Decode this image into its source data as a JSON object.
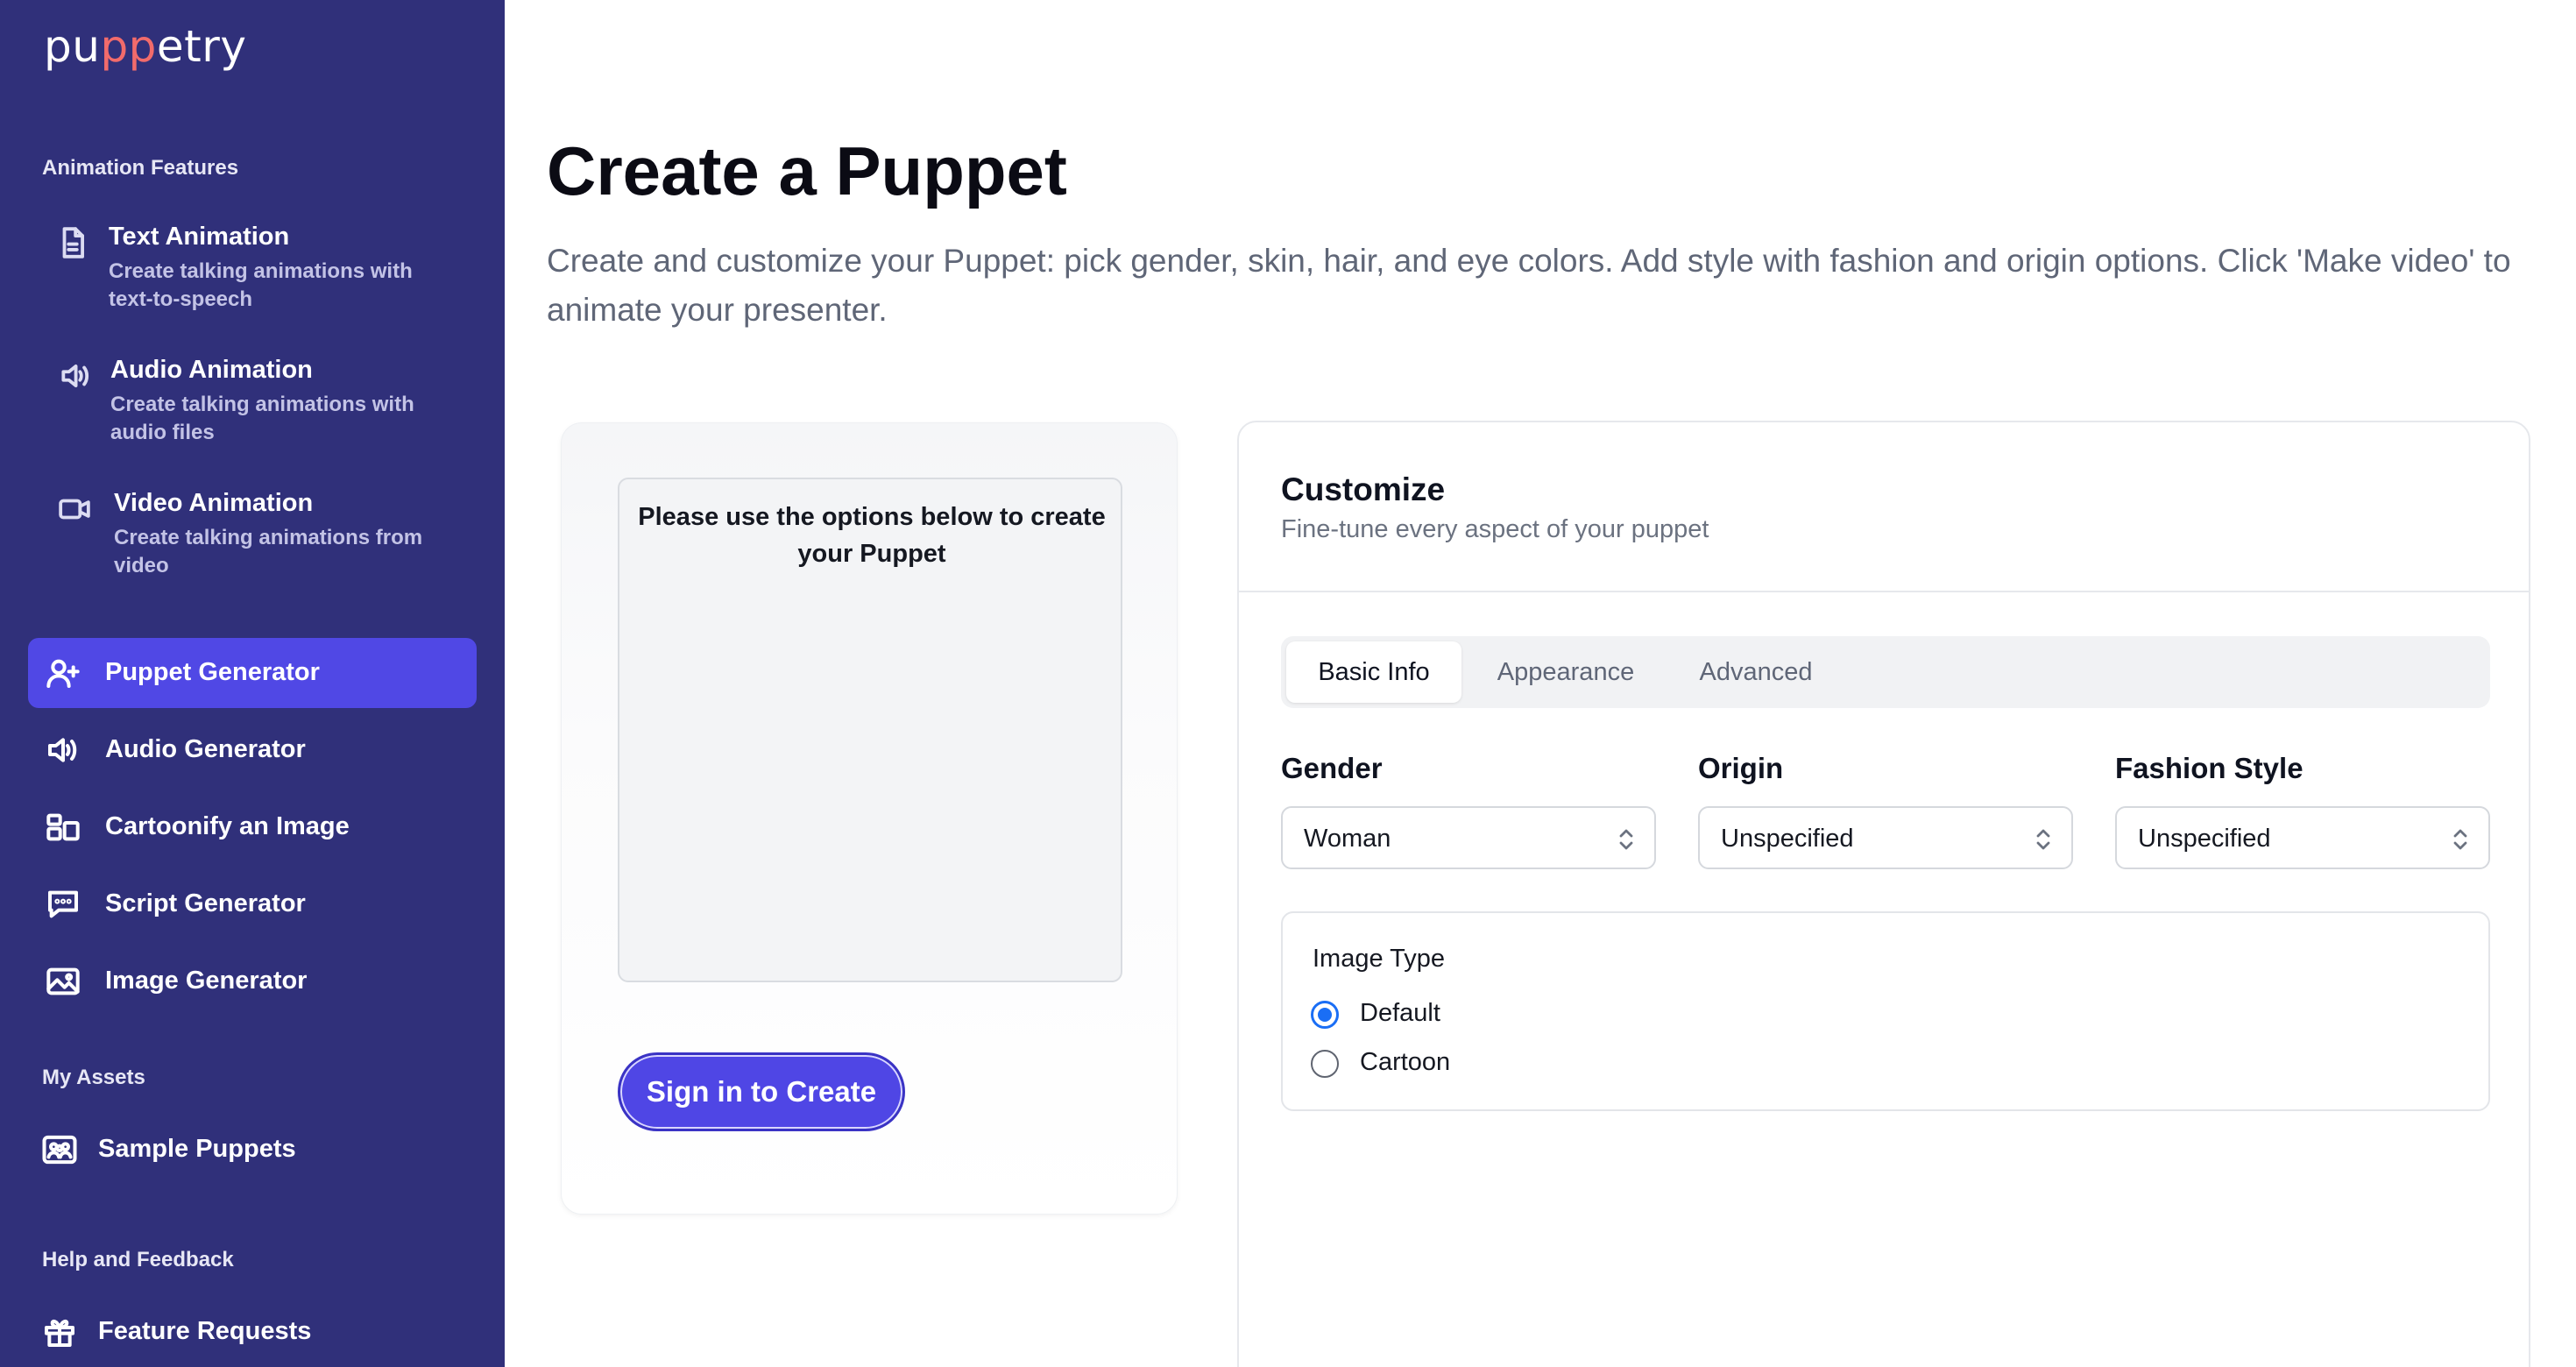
{
  "brand": {
    "logo_pre": "pu",
    "logo_mid": "pp",
    "logo_post": "etry"
  },
  "sidebar": {
    "animation_section": "Animation Features",
    "features": [
      {
        "title": "Text Animation",
        "desc": "Create talking animations with text-to-speech",
        "icon": "document-icon"
      },
      {
        "title": "Audio Animation",
        "desc": "Create talking animations with audio files",
        "icon": "speaker-icon"
      },
      {
        "title": "Video Animation",
        "desc": "Create talking animations from video",
        "icon": "video-camera-icon"
      }
    ],
    "nav": [
      {
        "label": "Puppet Generator",
        "icon": "user-plus-icon",
        "active": true
      },
      {
        "label": "Audio Generator",
        "icon": "speaker-icon"
      },
      {
        "label": "Cartoonify an Image",
        "icon": "layout-icon"
      },
      {
        "label": "Script Generator",
        "icon": "chat-bubble-icon"
      },
      {
        "label": "Image Generator",
        "icon": "image-icon"
      }
    ],
    "assets_section": "My Assets",
    "assets": [
      {
        "label": "Sample Puppets",
        "icon": "people-icon"
      }
    ],
    "help_section": "Help and Feedback",
    "help": [
      {
        "label": "Feature Requests",
        "icon": "gift-icon"
      }
    ]
  },
  "main": {
    "title": "Create a Puppet",
    "description": "Create and customize your Puppet: pick gender, skin, hair, and eye colors. Add style with fashion and origin options. Click 'Make video' to animate your presenter.",
    "preview": {
      "message": "Please use the options below to create your Puppet",
      "button": "Sign in to Create"
    },
    "customize": {
      "title": "Customize",
      "subtitle": "Fine-tune every aspect of your puppet",
      "tabs": [
        "Basic Info",
        "Appearance",
        "Advanced"
      ],
      "active_tab": "Basic Info",
      "fields": [
        {
          "label": "Gender",
          "value": "Woman"
        },
        {
          "label": "Origin",
          "value": "Unspecified"
        },
        {
          "label": "Fashion Style",
          "value": "Unspecified"
        }
      ],
      "image_type": {
        "label": "Image Type",
        "options": [
          "Default",
          "Cartoon"
        ],
        "selected": "Default"
      }
    }
  },
  "colors": {
    "sidebar_bg": "#30307a",
    "accent": "#4f46e5",
    "radio_selected": "#1a6ef5",
    "logo_accent": "#f26b6b"
  }
}
